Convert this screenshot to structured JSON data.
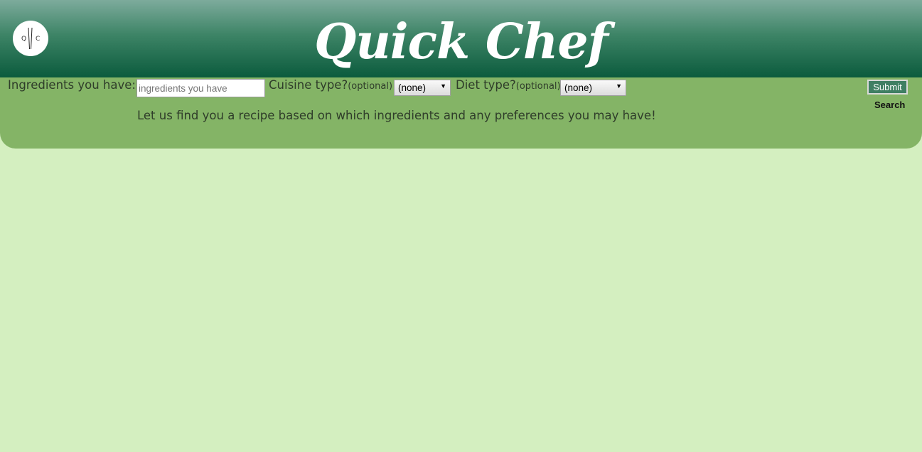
{
  "header": {
    "logo": {
      "letter_left": "Q",
      "letter_right": "C",
      "icon": "chopsticks-icon"
    },
    "title": "Quick Chef"
  },
  "search": {
    "ingredients_label": "Ingredients you have:",
    "ingredients_placeholder": "ingredients you have",
    "ingredients_value": "",
    "cuisine_label": "Cuisine type?",
    "cuisine_optional": "(optional)",
    "cuisine_selected": "(none)",
    "diet_label": "Diet type?",
    "diet_optional": "(optional)",
    "diet_selected": "(none)",
    "submit_label": "Submit",
    "submit_caption": "Search",
    "tagline": "Let us find you a recipe based on which ingredients and any preferences you may have!"
  },
  "colors": {
    "header_top": "#7dab9c",
    "header_bottom": "#0b5b3d",
    "panel": "#84b466",
    "page_background": "#d4efc0",
    "submit_button": "#3f7f63"
  }
}
